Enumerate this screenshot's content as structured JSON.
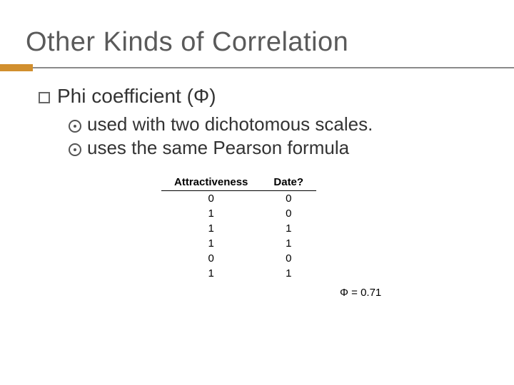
{
  "title": "Other Kinds of Correlation",
  "level1": {
    "text": "Phi coefficient (Φ)"
  },
  "level2": [
    "used with two dichotomous scales.",
    "uses the same Pearson formula"
  ],
  "table": {
    "headers": [
      "Attractiveness",
      "Date?"
    ],
    "rows": [
      [
        "0",
        "0"
      ],
      [
        "1",
        "0"
      ],
      [
        "1",
        "1"
      ],
      [
        "1",
        "1"
      ],
      [
        "0",
        "0"
      ],
      [
        "1",
        "1"
      ]
    ]
  },
  "phi_result": "Φ = 0.71",
  "chart_data": {
    "type": "table",
    "title": "Phi coefficient data",
    "columns": [
      "Attractiveness",
      "Date?"
    ],
    "rows": [
      [
        0,
        0
      ],
      [
        1,
        0
      ],
      [
        1,
        1
      ],
      [
        1,
        1
      ],
      [
        0,
        0
      ],
      [
        1,
        1
      ]
    ],
    "statistic": {
      "name": "Phi",
      "symbol": "Φ",
      "value": 0.71
    }
  }
}
